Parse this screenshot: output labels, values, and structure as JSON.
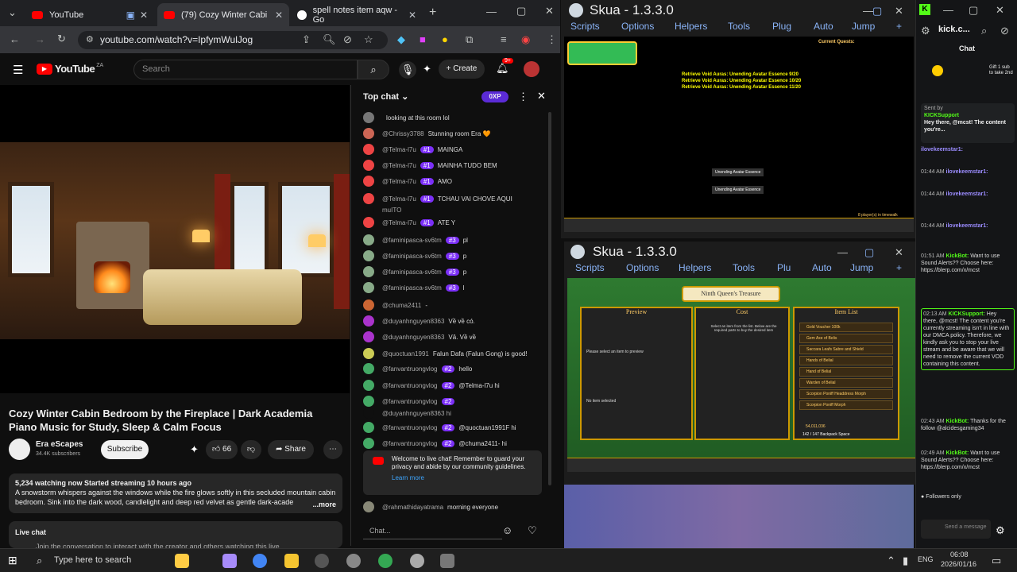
{
  "browser": {
    "tabs": [
      {
        "title": "YouTube"
      },
      {
        "title": "(79) Cozy Winter Cabi"
      },
      {
        "title": "spell notes item aqw - Go"
      }
    ],
    "url": "youtube.com/watch?v=IpfymWulJog"
  },
  "youtube": {
    "logo": "YouTube",
    "logo_sup": "ZA",
    "search_placeholder": "Search",
    "create_label": "Create",
    "notif_count": "9+",
    "video_title": "Cozy Winter Cabin Bedroom by the Fireplace | Dark Academia Piano Music for Study, Sleep & Calm Focus",
    "channel": "Era eScapes",
    "subscribers": "34.4K subscribers",
    "subscribe_label": "Subscribe",
    "likes": "66",
    "share_label": "Share",
    "desc_stats": "5,234 watching now  Started streaming 10 hours ago",
    "desc_text": "A snowstorm whispers against the windows while the fire glows softly in this secluded mountain cabin bedroom. Sink into the dark wood, candlelight and deep red velvet as gentle dark-acade",
    "desc_more": "...more",
    "live_chat_title": "Live chat",
    "live_chat_text": "Join the conversation to interact with the creator and others watching this live"
  },
  "chat": {
    "title": "Top chat",
    "points": "0XP",
    "input_placeholder": "Chat...",
    "welcome": "Welcome to live chat! Remember to guard your privacy and abide by our community guidelines.",
    "learn_more": "Learn more",
    "messages": [
      {
        "name": "",
        "badge": "",
        "text": "looking at this room lol",
        "color": "#777"
      },
      {
        "name": "@Chrissy3788",
        "badge": "",
        "text": "Stunning room Era 🧡",
        "color": "#c65"
      },
      {
        "name": "@Telma-l7u",
        "badge": "#1",
        "text": "MAINGA",
        "color": "#e44"
      },
      {
        "name": "@Telma-l7u",
        "badge": "#1",
        "text": "MAINHA TUDO BEM",
        "color": "#e44"
      },
      {
        "name": "@Telma-l7u",
        "badge": "#1",
        "text": "AMO",
        "color": "#e44"
      },
      {
        "name": "@Telma-l7u",
        "badge": "#1",
        "text": "TCHAU VAI CHOVE AQUI",
        "color": "#e44"
      },
      {
        "name": "muITO",
        "badge": "",
        "text": "",
        "color": "#0f0f0f"
      },
      {
        "name": "@Telma-l7u",
        "badge": "#1",
        "text": "ATE Y",
        "color": "#e44"
      },
      {
        "name": "@faminipasca-sv6tm",
        "badge": "#3",
        "text": "pl",
        "color": "#8a8"
      },
      {
        "name": "@faminipasca-sv6tm",
        "badge": "#3",
        "text": "p",
        "color": "#8a8"
      },
      {
        "name": "@faminipasca-sv6tm",
        "badge": "#3",
        "text": "p",
        "color": "#8a8"
      },
      {
        "name": "@faminipasca-sv6tm",
        "badge": "#3",
        "text": "l",
        "color": "#8a8"
      },
      {
        "name": "@chuma2411",
        "badge": "",
        "text": "-",
        "color": "#c63"
      },
      {
        "name": "@duyanhnguyen8363",
        "badge": "",
        "text": "Về về có.",
        "color": "#a3c"
      },
      {
        "name": "@duyanhnguyen8363",
        "badge": "",
        "text": "Vâ. Về về",
        "color": "#a3c"
      },
      {
        "name": "@quoctuan1991",
        "badge": "",
        "text": "Falun Dafa (Falun Gong) is good!",
        "color": "#cc5"
      },
      {
        "name": "@fanvantruongvlog",
        "badge": "#2",
        "text": "hello",
        "color": "#4a6"
      },
      {
        "name": "@fanvantruongvlog",
        "badge": "#2",
        "text": "@Telma-l7u hi",
        "color": "#4a6"
      },
      {
        "name": "@fanvantruongvlog",
        "badge": "#2",
        "text": "",
        "color": "#4a6"
      },
      {
        "name": "@duyanhnguyen8363 hi",
        "badge": "",
        "text": "",
        "color": "#0f0f0f"
      },
      {
        "name": "@fanvantruongvlog",
        "badge": "#2",
        "text": "@quoctuan1991F hi",
        "color": "#4a6"
      },
      {
        "name": "@fanvantruongvlog",
        "badge": "#2",
        "text": "@chuma2411- hi",
        "color": "#4a6"
      }
    ],
    "last": {
      "name": "@rahmathidayatrama",
      "text": "morning everyone"
    }
  },
  "skua1": {
    "title": "Skua - 1.3.3.0",
    "menu": [
      "Scripts",
      "Options",
      "Helpers",
      "Tools",
      "Plug",
      "Auto",
      "Jump",
      "+"
    ],
    "quests": "Current Quests:",
    "log": [
      "Retrieve Void Auras: Unending Avatar Essence 9/20",
      "Retrieve Void Auras: Unending Avatar Essence 10/20",
      "Retrieve Void Auras: Unending Avatar Essence 11/20"
    ],
    "items": [
      "Unending Avatar Essence",
      "Unending Avatar Essence"
    ],
    "players": "8 player(s) in timewalk"
  },
  "skua2": {
    "title": "Skua - 1.3.3.0",
    "menu": [
      "Scripts",
      "Options",
      "Helpers",
      "Tools",
      "Plu",
      "Auto",
      "Jump",
      "+"
    ],
    "shop": "Ninth Queen's Treasure",
    "preview": "Preview",
    "cost": "Cost",
    "item_list": "Item List",
    "preview_note": "Please select an item to preview",
    "no_item": "No item selected",
    "cost_note": "Select an item from the list. Below are the required parts to buy the desired item",
    "items": [
      "Gold Voucher 100k",
      "Gem Axe of Belis",
      "Saccara Leafs Sabre and Shield",
      "Hands of Belial",
      "Hand of Belial",
      "Warden of Belial",
      "Scorpion Poniff Headdress Morph",
      "Scorpion Poniff Morph"
    ],
    "gold": "54,011,036",
    "backpack": "142 / 147  Backpack Space"
  },
  "kick": {
    "title": "kick.c...",
    "chat_title": "Chat",
    "gift_text": "Gift 1 sub to take 2nd",
    "sent_by": "Sent by",
    "support": "KICKSupport",
    "pinned": "Hey there, @mcst! The content you're...",
    "msgs": [
      {
        "time": "",
        "name": "ilovekeemstar1:",
        "text": ""
      },
      {
        "time": "01:44 AM",
        "name": "ilovekeemstar1:",
        "text": ""
      },
      {
        "time": "01:44 AM",
        "name": "ilovekeemstar1:",
        "text": ""
      },
      {
        "time": "01:44 AM",
        "name": "ilovekeemstar1:",
        "text": ""
      },
      {
        "time": "01:51 AM",
        "name": "KickBot:",
        "text": "Want to use Sound Alerts?? Choose here: https://blerp.com/x/mcst"
      },
      {
        "time": "02:13 AM",
        "name": "KICKSupport:",
        "text": "Hey there, @mcst! The content you're currently streaming isn't in line with our DMCA policy. Therefore, we kindly ask you to stop your live stream and be aware that we will need to remove the current VOD containing this content."
      },
      {
        "time": "02:43 AM",
        "name": "KickBot:",
        "text": "Thanks for the follow @alcidesgaming34"
      },
      {
        "time": "02:49 AM",
        "name": "KickBot:",
        "text": "Want to use Sound Alerts?? Choose here: https://blerp.com/x/mcst"
      }
    ],
    "followers": "Followers only",
    "send": "Send a message"
  },
  "taskbar": {
    "search": "Type here to search",
    "lang": "ENG",
    "time": "06:08",
    "date": "2026/01/16"
  }
}
